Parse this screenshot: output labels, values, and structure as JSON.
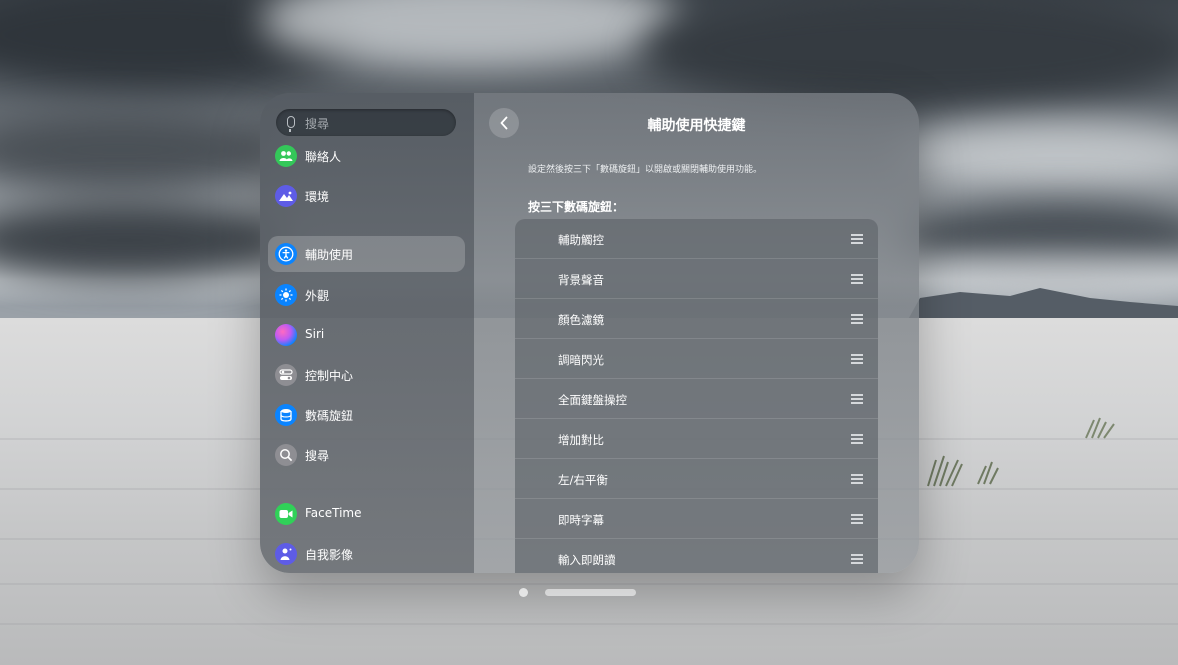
{
  "sidebar": {
    "search_placeholder": "搜尋",
    "items": [
      {
        "label": "聯絡人",
        "icon": "contacts-icon",
        "color": "#34c759"
      },
      {
        "label": "環境",
        "icon": "environments-icon",
        "color": "#5e5ce6"
      },
      {
        "label": "輔助使用",
        "icon": "accessibility-icon",
        "color": "#0a84ff",
        "selected": true
      },
      {
        "label": "外觀",
        "icon": "appearance-icon",
        "color": "#0a84ff"
      },
      {
        "label": "Siri",
        "icon": "siri-icon",
        "color": "#bf5af2"
      },
      {
        "label": "控制中心",
        "icon": "control-center-icon",
        "color": "#8e8e93"
      },
      {
        "label": "數碼旋鈕",
        "icon": "digital-crown-icon",
        "color": "#0a84ff"
      },
      {
        "label": "搜尋",
        "icon": "search-icon",
        "color": "#8e8e93"
      },
      {
        "label": "FaceTime",
        "icon": "facetime-icon",
        "color": "#30d158"
      },
      {
        "label": "自我影像",
        "icon": "persona-icon",
        "color": "#5e5ce6"
      }
    ]
  },
  "main": {
    "title": "輔助使用快捷鍵",
    "description": "設定然後按三下「數碼旋鈕」以開啟或關閉輔助使用功能。",
    "section_header": "按三下數碼旋鈕：",
    "shortcuts": [
      "輔助觸控",
      "背景聲音",
      "顏色濾鏡",
      "調暗閃光",
      "全面鍵盤操控",
      "增加對比",
      "左/右平衡",
      "即時字幕",
      "輸入即朗讀"
    ]
  }
}
